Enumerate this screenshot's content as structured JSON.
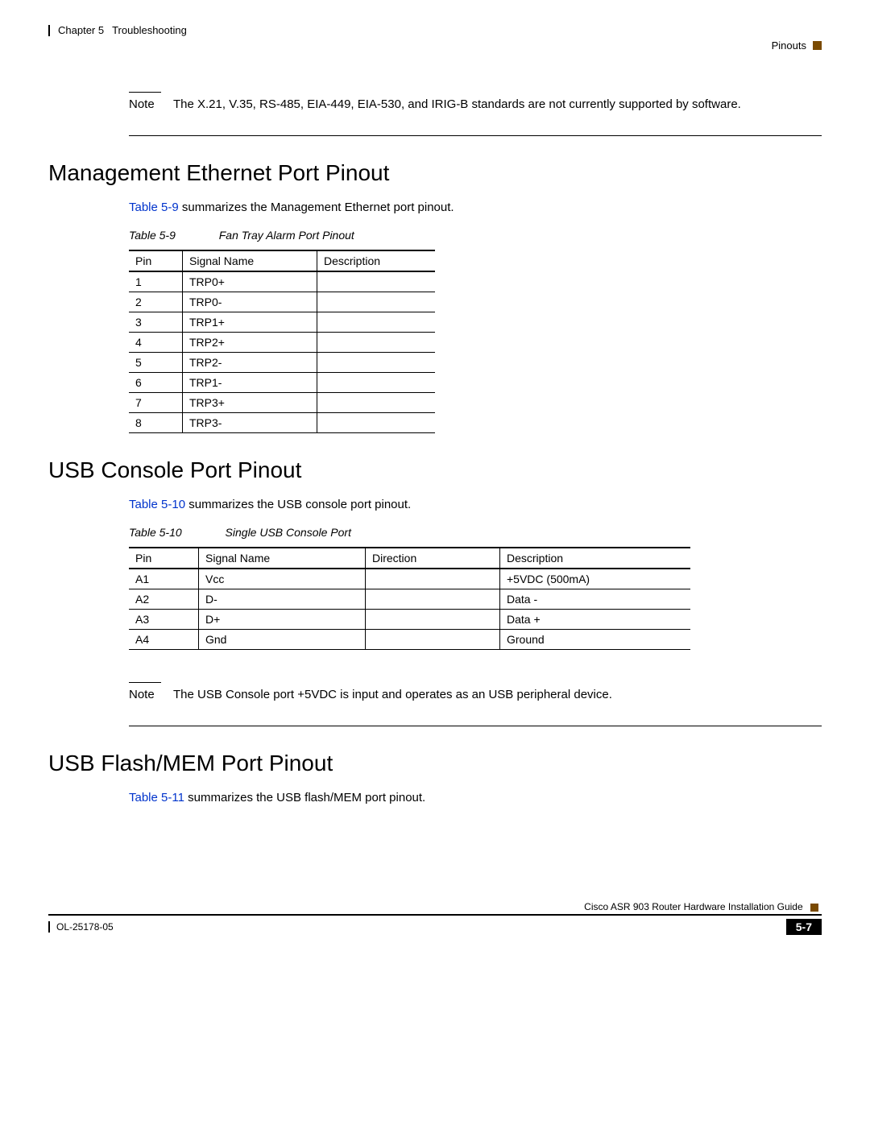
{
  "header": {
    "chapter": "Chapter 5",
    "title": "Troubleshooting",
    "section": "Pinouts"
  },
  "note1": {
    "label": "Note",
    "text": "The X.21, V.35, RS-485, EIA-449, EIA-530, and IRIG-B standards are not currently supported by software."
  },
  "sec1": {
    "heading": "Management Ethernet Port Pinout",
    "intro_ref": "Table 5-9",
    "intro_rest": " summarizes the Management Ethernet port pinout.",
    "caption_num": "Table 5-9",
    "caption_title": "Fan Tray Alarm Port Pinout",
    "cols": [
      "Pin",
      "Signal Name",
      "Description"
    ],
    "rows": [
      [
        "1",
        "TRP0+",
        ""
      ],
      [
        "2",
        "TRP0-",
        ""
      ],
      [
        "3",
        "TRP1+",
        ""
      ],
      [
        "4",
        "TRP2+",
        ""
      ],
      [
        "5",
        "TRP2-",
        ""
      ],
      [
        "6",
        "TRP1-",
        ""
      ],
      [
        "7",
        "TRP3+",
        ""
      ],
      [
        "8",
        "TRP3-",
        ""
      ]
    ]
  },
  "sec2": {
    "heading": "USB Console Port Pinout",
    "intro_ref": "Table 5-10",
    "intro_rest": " summarizes the USB console port pinout.",
    "caption_num": "Table 5-10",
    "caption_title": "Single USB Console Port",
    "cols": [
      "Pin",
      "Signal Name",
      "Direction",
      "Description"
    ],
    "rows": [
      [
        "A1",
        "Vcc",
        "",
        "+5VDC (500mA)"
      ],
      [
        "A2",
        "D-",
        "",
        "Data -"
      ],
      [
        "A3",
        "D+",
        "",
        "Data +"
      ],
      [
        "A4",
        "Gnd",
        "",
        "Ground"
      ]
    ]
  },
  "note2": {
    "label": "Note",
    "text": "The USB Console port +5VDC is input and operates as an USB peripheral device."
  },
  "sec3": {
    "heading": "USB Flash/MEM Port Pinout",
    "intro_ref": "Table 5-11",
    "intro_rest": " summarizes the USB flash/MEM port pinout."
  },
  "footer": {
    "guide": "Cisco ASR 903 Router Hardware Installation Guide",
    "doc": "OL-25178-05",
    "page": "5-7"
  }
}
